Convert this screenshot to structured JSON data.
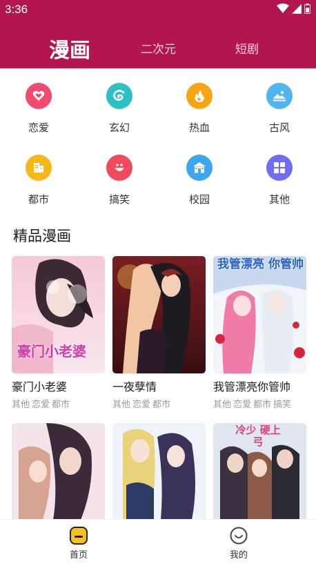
{
  "status": {
    "time": "3:36"
  },
  "tabs": [
    {
      "label": "漫画",
      "active": true
    },
    {
      "label": "二次元",
      "active": false
    },
    {
      "label": "短剧",
      "active": false
    }
  ],
  "categories": [
    {
      "label": "恋爱",
      "icon": "heart-icon",
      "color": "#f04a6e"
    },
    {
      "label": "玄幻",
      "icon": "swirl-icon",
      "color": "#2cc1c4"
    },
    {
      "label": "热血",
      "icon": "flame-icon",
      "color": "#f5a511"
    },
    {
      "label": "古风",
      "icon": "mountain-icon",
      "color": "#4fb4ef"
    },
    {
      "label": "都市",
      "icon": "building-icon",
      "color": "#f5b816"
    },
    {
      "label": "搞笑",
      "icon": "smile-icon",
      "color": "#f04a5d"
    },
    {
      "label": "校园",
      "icon": "school-icon",
      "color": "#3ea6ef"
    },
    {
      "label": "其他",
      "icon": "grid-icon",
      "color": "#6f6ef2"
    }
  ],
  "section": {
    "title": "精品漫画"
  },
  "comics": [
    {
      "title": "豪门小老婆",
      "tags": [
        "其他",
        "恋爱",
        "都市"
      ],
      "cover_text": "豪门小老婆"
    },
    {
      "title": "一夜孽情",
      "tags": [
        "其他",
        "恋爱",
        "都市"
      ],
      "cover_text": ""
    },
    {
      "title": "我管漂亮你管帅",
      "tags": [
        "其他",
        "恋爱",
        "都市",
        "搞笑"
      ],
      "cover_text": "我管漂亮 你管帅"
    },
    {
      "title": "",
      "tags": [],
      "cover_text": ""
    },
    {
      "title": "",
      "tags": [],
      "cover_text": ""
    },
    {
      "title": "",
      "tags": [],
      "cover_text": "冷少 硬上弓"
    }
  ],
  "bottom_nav": [
    {
      "label": "首页",
      "active": true
    },
    {
      "label": "我的",
      "active": false
    }
  ],
  "colors": {
    "brand": "#b3164f",
    "home_icon": "#f5c21b"
  }
}
